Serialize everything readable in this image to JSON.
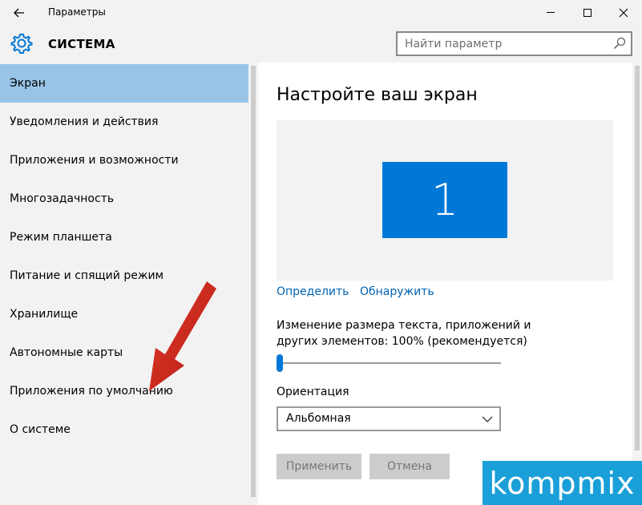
{
  "window": {
    "title": "Параметры",
    "back_icon": "arrow-left-icon",
    "minimize_glyph": "—",
    "maximize_glyph": "☐",
    "close_glyph": "✕"
  },
  "header": {
    "section_title": "СИСТЕМА",
    "search_placeholder": "Найти параметр",
    "accent_color": "#0078d7"
  },
  "sidebar": {
    "items": [
      {
        "label": "Экран",
        "active": true
      },
      {
        "label": "Уведомления и действия"
      },
      {
        "label": "Приложения и возможности"
      },
      {
        "label": "Многозадачность"
      },
      {
        "label": "Режим планшета"
      },
      {
        "label": "Питание и спящий режим"
      },
      {
        "label": "Хранилище"
      },
      {
        "label": "Автономные карты"
      },
      {
        "label": "Приложения по умолчанию"
      },
      {
        "label": "О системе"
      }
    ],
    "active_color": "#99c4e8"
  },
  "main": {
    "title": "Настройте ваш экран",
    "monitor_number": "1",
    "identify_link": "Определить",
    "detect_link": "Обнаружить",
    "scale_label": "Изменение размера текста, приложений и других элементов: 100% (рекомендуется)",
    "scale_slider_fraction": 0.0,
    "orientation_label": "Ориентация",
    "orientation_value": "Альбомная",
    "apply_button": "Применить",
    "cancel_button": "Отмена"
  },
  "watermark": {
    "text": "kompmix"
  }
}
